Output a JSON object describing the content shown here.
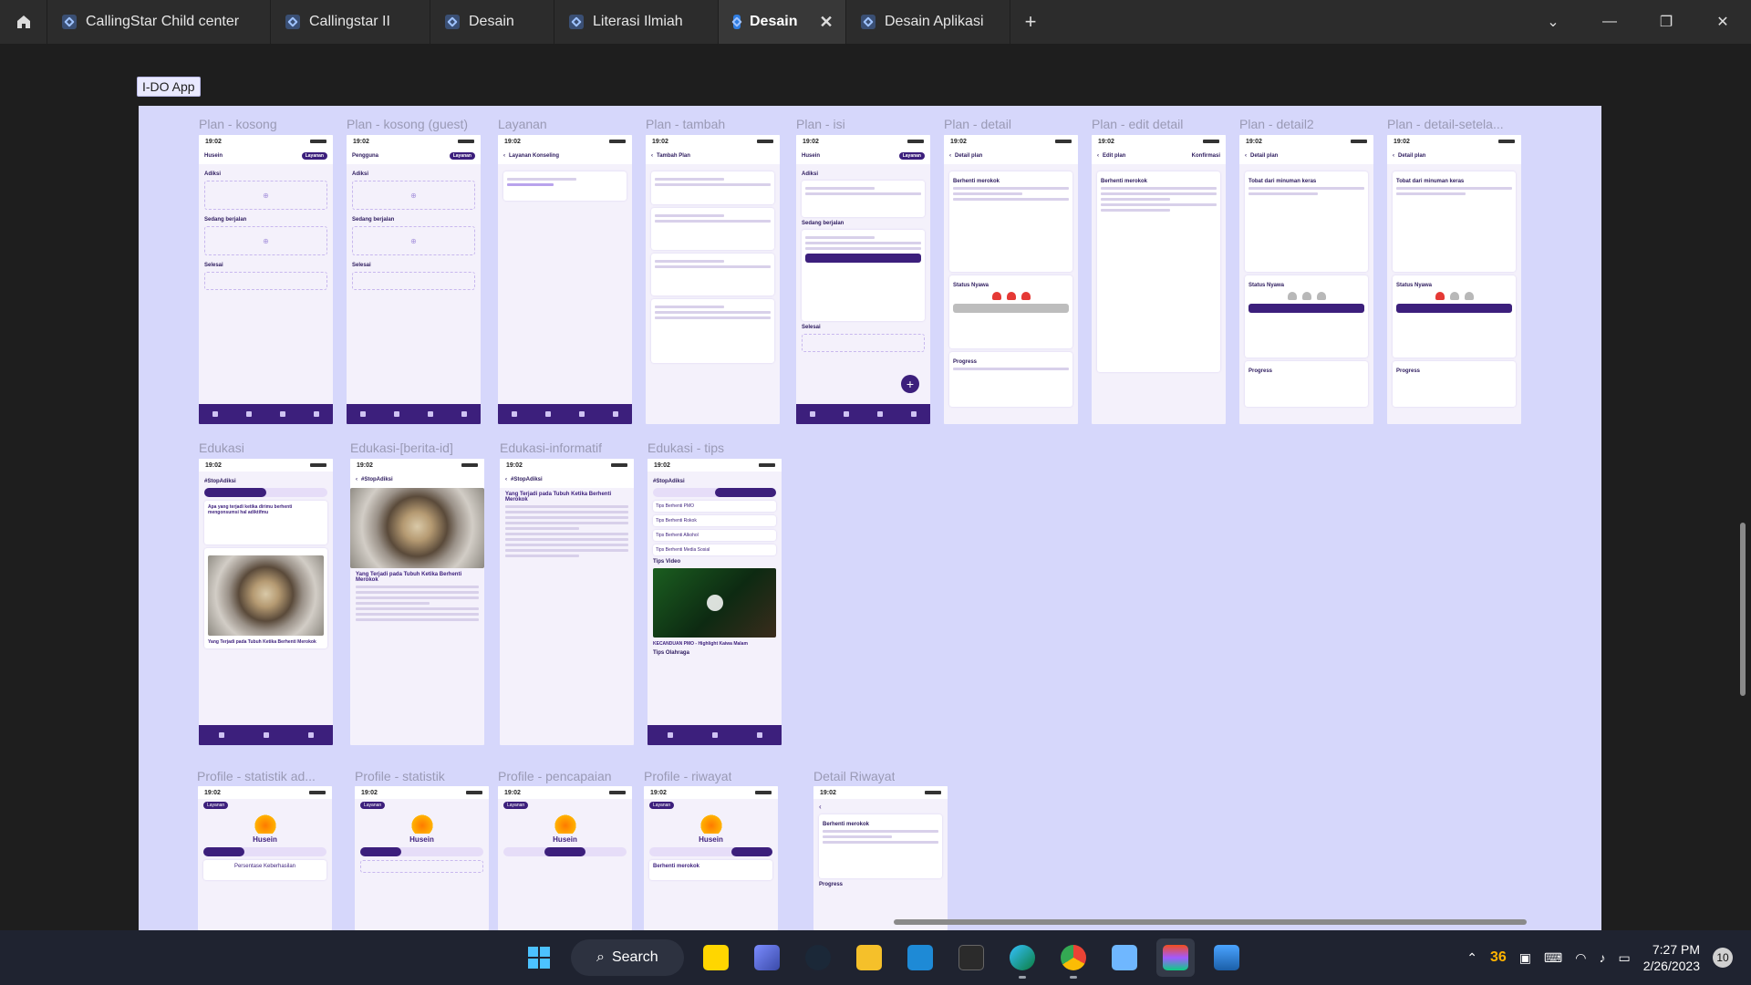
{
  "tabs": [
    {
      "label": "CallingStar Child center",
      "active": false
    },
    {
      "label": "Callingstar II",
      "active": false
    },
    {
      "label": "Desain",
      "active": false
    },
    {
      "label": "Literasi Ilmiah",
      "active": false
    },
    {
      "label": "Desain",
      "active": true
    },
    {
      "label": "Desain Aplikasi",
      "active": false
    }
  ],
  "section_label": "I-DO App",
  "frames": {
    "row1": [
      "Plan - kosong",
      "Plan - kosong (guest)",
      "Layanan",
      "Plan - tambah",
      "Plan - isi",
      "Plan - detail",
      "Plan - edit detail",
      "Plan - detail2",
      "Plan - detail-setela..."
    ],
    "row2": [
      "Edukasi",
      "Edukasi-[berita-id]",
      "Edukasi-informatif",
      "Edukasi - tips"
    ],
    "row3": [
      "Profile - statistik ad...",
      "Profile - statistik",
      "Profile - pencapaian",
      "Profile - riwayat",
      "Detail Riwayat"
    ]
  },
  "screen": {
    "time": "19:02",
    "user_husein": "Husein",
    "user_guest": "Pengguna",
    "btn_layanan": "Layanan",
    "adiksi": "Adiksi",
    "sedang_berjalan": "Sedang berjalan",
    "selesai": "Selesai",
    "layanan_konseling": "Layanan Konseling",
    "tambah_plan": "Tambah Plan",
    "detail_plan": "Detail plan",
    "edit_plan": "Edit plan",
    "konfirmasi": "Konfirmasi",
    "berhenti_merokok": "Berhenti merokok",
    "tobat": "Tobat dari minuman keras",
    "status_nyawa": "Status Nyawa",
    "progress": "Progress",
    "stop_adiksi": "#StopAdiksi",
    "berita": "Berita",
    "tips": "Tips",
    "article_title": "Yang Terjadi pada Tubuh Ketika Berhenti Merokok",
    "article_card": "Apa yang terjadi ketika dirimu berhenti mengonsumsi hal adiktifmu",
    "tips_video": "Tips Video",
    "tips_olahraga": "Tips Olahraga",
    "tips_items": [
      "Tips Berhenti PMO",
      "Tips Berhenti Rokok",
      "Tips Berhenti Alkohol",
      "Tips Berhenti Media Sosial"
    ],
    "profile_tabs": [
      "Statistik",
      "Pencapaian",
      "Riwayat"
    ],
    "persentase": "Persentase Keberhasilan",
    "video_caption": "KECANDUAN PMO - Highlight Kaiwa Malam"
  },
  "taskbar": {
    "search": "Search",
    "temp": "36",
    "time": "7:27 PM",
    "date": "2/26/2023",
    "notifications": "10"
  }
}
